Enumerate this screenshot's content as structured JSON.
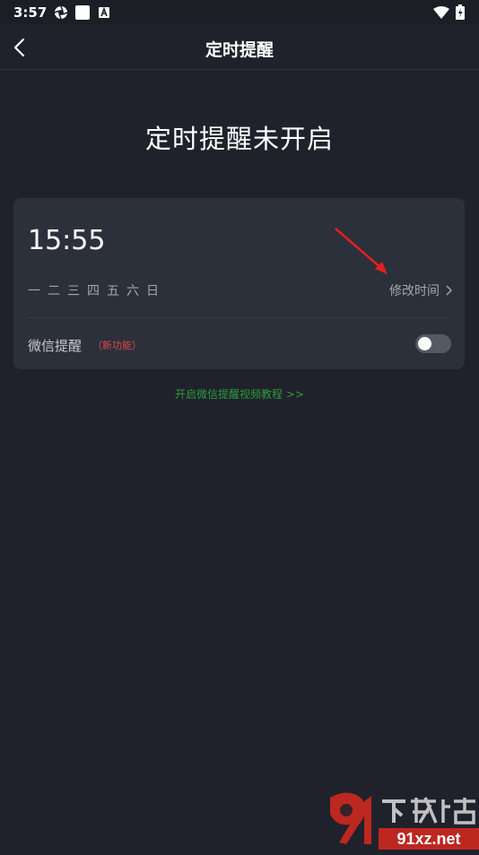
{
  "status_bar": {
    "time": "3:57"
  },
  "nav": {
    "title": "定时提醒"
  },
  "status_heading": "定时提醒未开启",
  "reminder": {
    "time": "15:55",
    "weekdays": [
      "一",
      "二",
      "三",
      "四",
      "五",
      "六",
      "日"
    ],
    "modify_label": "修改时间"
  },
  "wechat": {
    "label": "微信提醒",
    "badge": "（新功能）",
    "enabled": false
  },
  "tutorial_link": "开启微信提醒视频教程 >>",
  "watermark": {
    "text": "下载站",
    "site": "91xz.net"
  },
  "colors": {
    "background": "#1f222a",
    "card": "#2c303a",
    "badge_red": "#e0474c",
    "link_green": "#2e9a3c",
    "annotation_arrow": "#e02020"
  }
}
